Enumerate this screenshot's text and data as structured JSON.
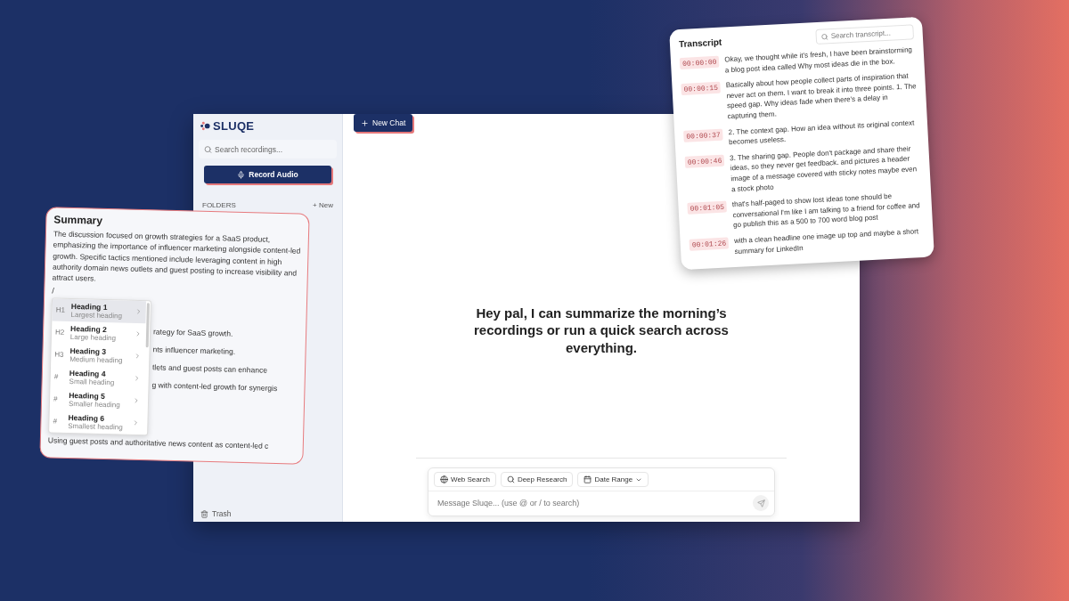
{
  "sidebar": {
    "logo": "SLUQE",
    "search": {
      "placeholder": "Search recordings..."
    },
    "record_button": "Record Audio",
    "folders_label": "FOLDERS",
    "new_folder": "+ New",
    "trash": "Trash"
  },
  "main": {
    "new_chat": "New Chat",
    "greeting": "Hey pal, I can summarize the morning’s recordings or run a quick search across everything.",
    "composer": {
      "chips": [
        {
          "kind": "globe",
          "label": "Web Search"
        },
        {
          "kind": "search",
          "label": "Deep Research"
        },
        {
          "kind": "calendar",
          "label": "Date Range"
        }
      ],
      "placeholder": "Message Sluqe... (use @ or / to search)"
    }
  },
  "summary": {
    "title": "Summary",
    "text": "The discussion focused on growth strategies for a SaaS product, emphasizing the importance of influencer marketing alongside content-led growth. Specific tactics mentioned include leveraging content in high authority domain news outlets and guest posting to increase visibility and attract users.",
    "slash": "/",
    "menu": [
      {
        "mark": "H1",
        "label": "Heading 1",
        "hint": "Largest heading",
        "selected": true
      },
      {
        "mark": "H2",
        "label": "Heading 2",
        "hint": "Large heading",
        "selected": false
      },
      {
        "mark": "H3",
        "label": "Heading 3",
        "hint": "Medium heading",
        "selected": false
      },
      {
        "mark": "#",
        "label": "Heading 4",
        "hint": "Small heading",
        "selected": false
      },
      {
        "mark": "#",
        "label": "Heading 5",
        "hint": "Smaller heading",
        "selected": false
      },
      {
        "mark": "#",
        "label": "Heading 6",
        "hint": "Smallest heading",
        "selected": false
      }
    ],
    "fragments": [
      "rategy for SaaS growth.",
      "nts influencer marketing.",
      "tlets and guest posts can enhance",
      "g with content-led growth for synergis"
    ],
    "last_line": "Using guest posts and authoritative news content as content-led c"
  },
  "transcript": {
    "title": "Transcript",
    "search": {
      "placeholder": "Search transcript..."
    },
    "entries": [
      {
        "time": "00:00:00",
        "text": "Okay, we thought while it's fresh, I have been brainstorming a blog post idea called Why most ideas die in the box."
      },
      {
        "time": "00:00:15",
        "text": "Basically about how people collect parts of inspiration that never act on them. I want to break it into three points. 1. The speed gap. Why ideas fade when there's a delay in capturing them."
      },
      {
        "time": "00:00:37",
        "text": "2. The context gap. How an idea without its original context becomes useless."
      },
      {
        "time": "00:00:46",
        "text": "3. The sharing gap. People don't package and share their ideas, so they never get feedback. and pictures a header image of a message covered with sticky notes maybe even a stock photo"
      },
      {
        "time": "00:01:05",
        "text": "that's half-paged to show lost ideas tone should be conversational I'm like I am talking to a friend for coffee and go publish this as a 500 to 700 word blog post"
      },
      {
        "time": "00:01:26",
        "text": "with a clean headline one image up top and maybe a short summary for LinkedIn"
      }
    ]
  }
}
